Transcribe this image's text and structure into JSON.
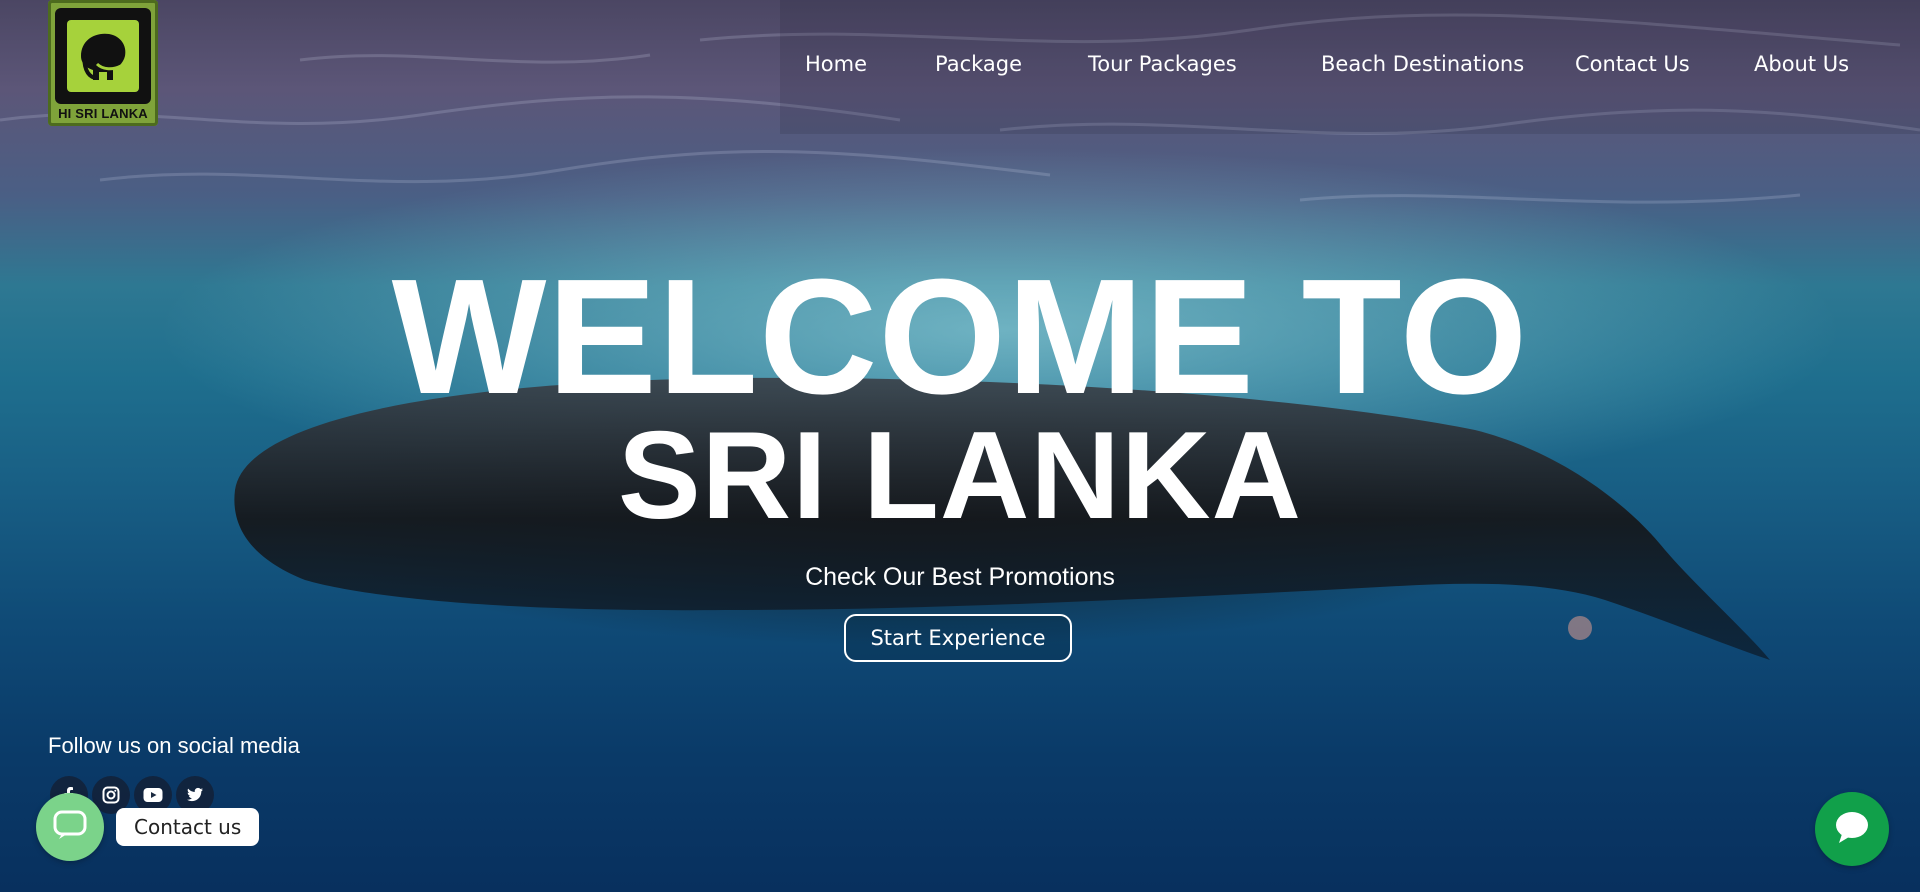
{
  "brand": {
    "logo_text": "HI SRI LANKA",
    "logo_icon": "elephant-icon",
    "colors": {
      "logo_green": "#a6d23b",
      "logo_border": "#7fa33a"
    }
  },
  "nav": {
    "items": [
      {
        "label": "Home"
      },
      {
        "label": "Package"
      },
      {
        "label": "Tour Packages"
      },
      {
        "label": "Beach Destinations"
      },
      {
        "label": "Contact Us"
      },
      {
        "label": "About Us"
      }
    ]
  },
  "hero": {
    "title_line1": "WELCOME TO",
    "title_line2": "SRI LANKA",
    "subtitle": "Check Our Best Promotions",
    "cta_label": "Start Experience"
  },
  "social": {
    "title": "Follow us on social media",
    "icons": [
      "facebook-icon",
      "instagram-icon",
      "youtube-icon",
      "twitter-icon"
    ]
  },
  "contact_widget": {
    "label": "Contact us",
    "icon": "chat-bubble-icon",
    "color": "#7bd38a"
  },
  "chat_widget": {
    "icon": "chat-icon",
    "color": "#11a04a"
  }
}
